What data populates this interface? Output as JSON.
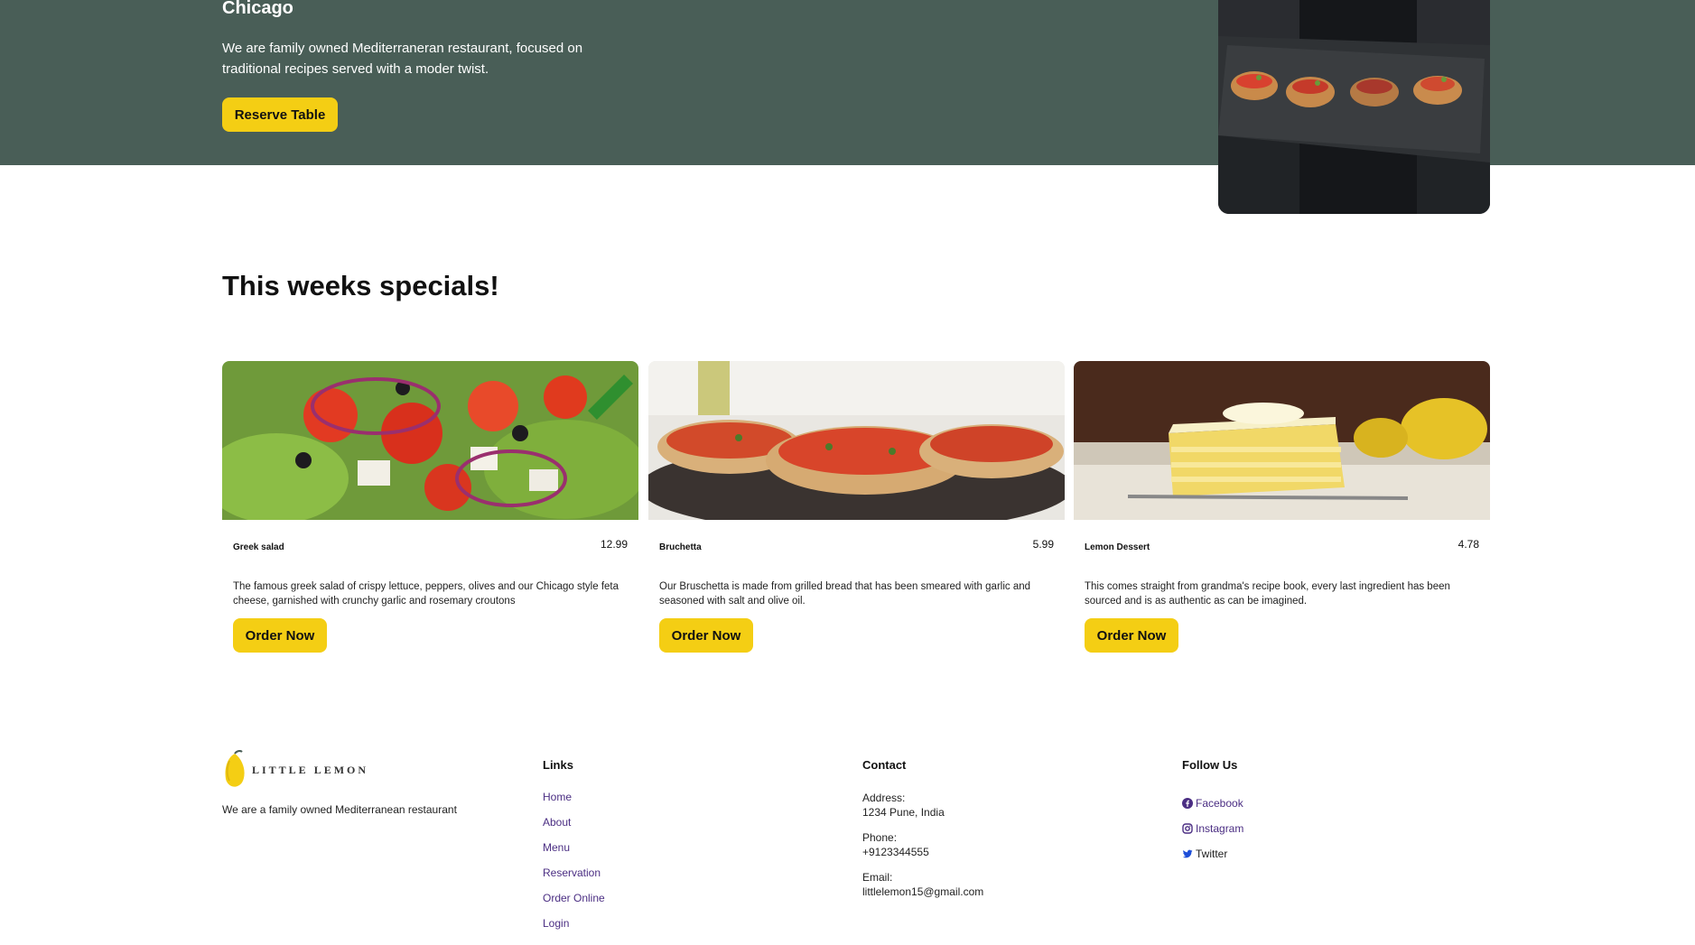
{
  "hero": {
    "city": "Chicago",
    "description": "We are family owned Mediterraneran restaurant, focused on traditional recipes served with a moder twist.",
    "button_label": "Reserve Table"
  },
  "specials": {
    "title": "This weeks specials!",
    "cards": [
      {
        "name": "Greek salad",
        "price": "12.99",
        "description": "The famous greek salad of crispy lettuce, peppers, olives and our Chicago style feta cheese, garnished with crunchy garlic and rosemary croutons",
        "button_label": "Order Now"
      },
      {
        "name": "Bruchetta",
        "price": "5.99",
        "description": "Our Bruschetta is made from grilled bread that has been smeared with garlic and seasoned with salt and olive oil.",
        "button_label": "Order Now"
      },
      {
        "name": "Lemon Dessert",
        "price": "4.78",
        "description": "This comes straight from grandma's recipe book, every last ingredient has been sourced and is as authentic as can be imagined.",
        "button_label": "Order Now"
      }
    ]
  },
  "footer": {
    "logo_text": "LITTLE LEMON",
    "tagline": "We are a family owned Mediterranean restaurant",
    "links_heading": "Links",
    "links": [
      "Home",
      "About",
      "Menu",
      "Reservation",
      "Order Online",
      "Login"
    ],
    "contact_heading": "Contact",
    "address_label": "Address:",
    "address_value": "1234 Pune, India",
    "phone_label": "Phone:",
    "phone_value": "+9123344555",
    "email_label": "Email:",
    "email_value": "littlelemon15@gmail.com",
    "follow_heading": "Follow Us",
    "social": [
      "Facebook",
      "Instagram",
      "Twitter"
    ]
  },
  "colors": {
    "hero_bg": "#495e57",
    "accent_yellow": "#f4ce14",
    "link_purple": "#4b2e83"
  }
}
